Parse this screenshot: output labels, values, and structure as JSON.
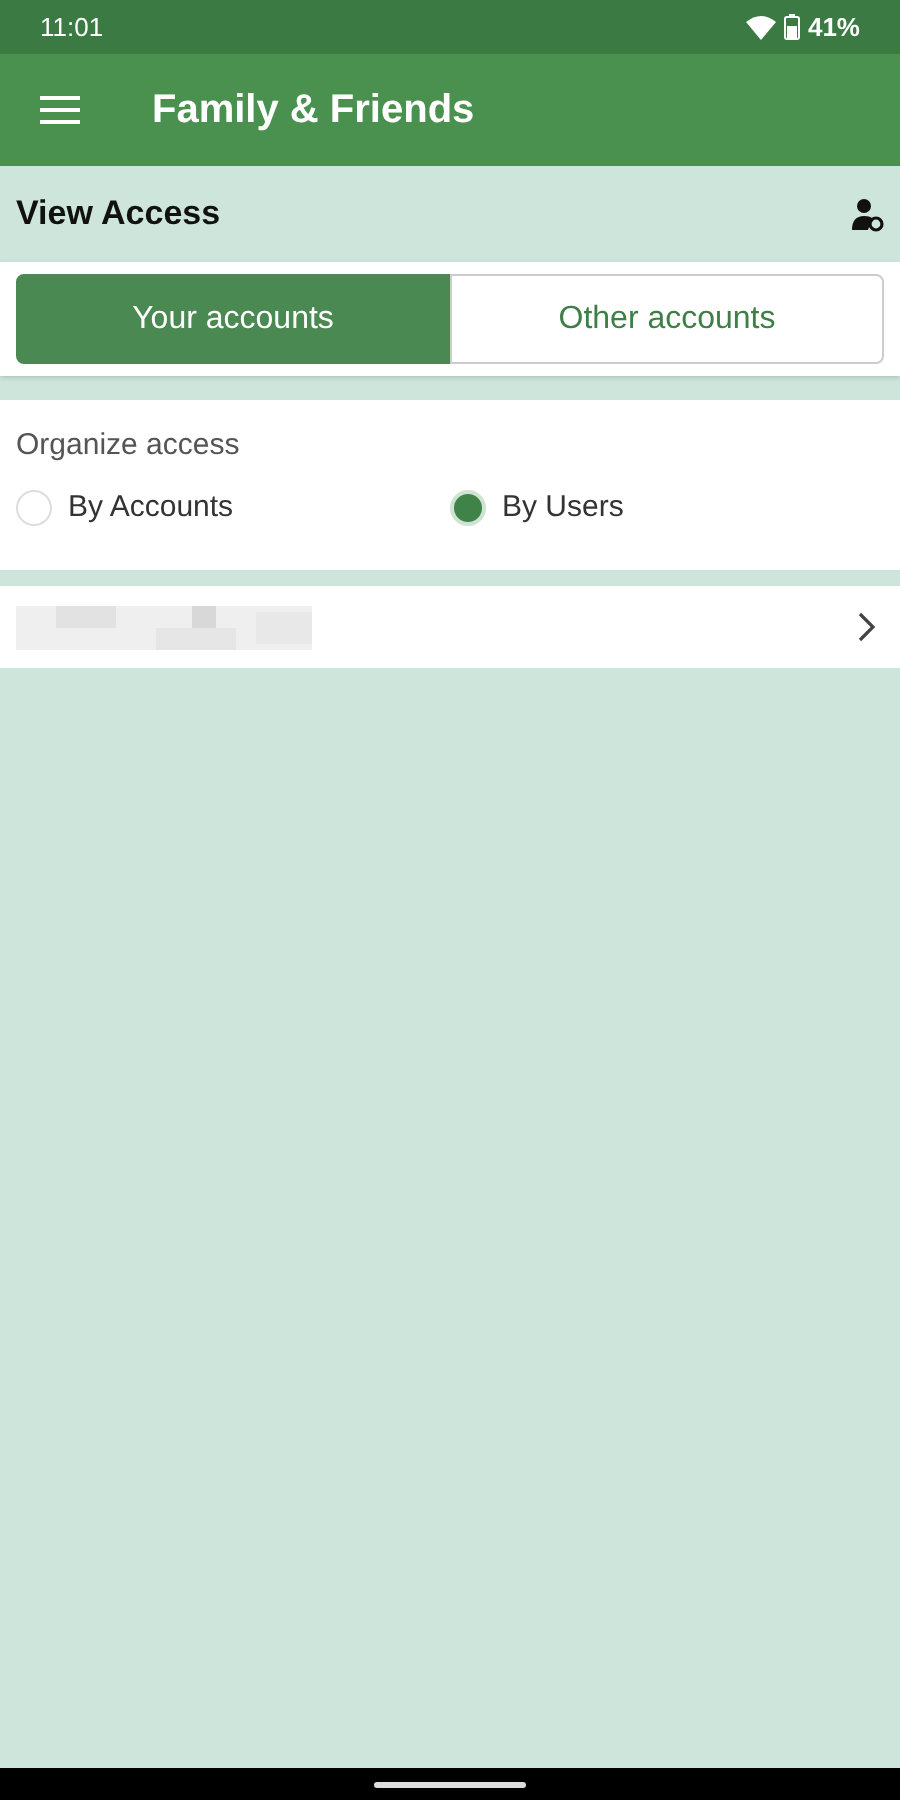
{
  "status_bar": {
    "time": "11:01",
    "battery": "41%"
  },
  "app_bar": {
    "title": "Family & Friends"
  },
  "section": {
    "title": "View Access"
  },
  "tabs": [
    {
      "label": "Your accounts",
      "selected": true
    },
    {
      "label": "Other accounts",
      "selected": false
    }
  ],
  "organize": {
    "label": "Organize access",
    "options": [
      {
        "label": "By Accounts",
        "selected": false
      },
      {
        "label": "By Users",
        "selected": true
      }
    ]
  },
  "users": [
    {
      "kind": "redacted"
    }
  ]
}
